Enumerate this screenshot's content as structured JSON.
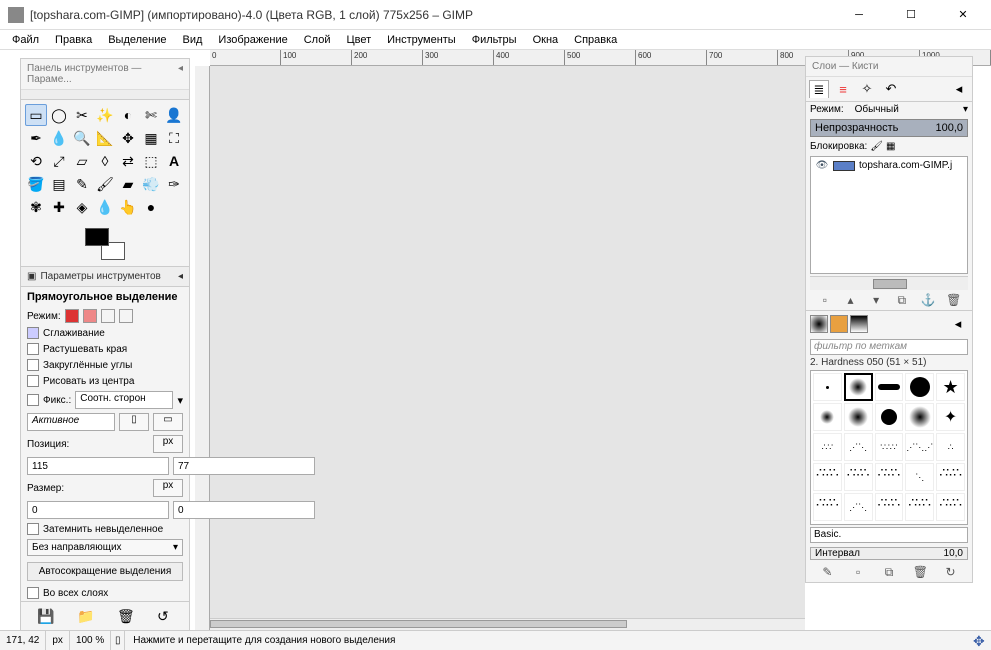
{
  "title": "[topshara.com-GIMP] (импортировано)-4.0 (Цвета RGB, 1 слой) 775x256 – GIMP",
  "menu": [
    "Файл",
    "Правка",
    "Выделение",
    "Вид",
    "Изображение",
    "Слой",
    "Цвет",
    "Инструменты",
    "Фильтры",
    "Окна",
    "Справка"
  ],
  "toolbox": {
    "header": "Панель инструментов — Параме...",
    "opts_label": "Параметры инструментов",
    "selection_title": "Прямоугольное выделение",
    "mode_label": "Режим:",
    "smooth": "Сглаживание",
    "feather": "Растушевать края",
    "rounded": "Закруглённые углы",
    "center": "Рисовать из центра",
    "fix_label": "Фикс.:",
    "fix_value": "Соотн. сторон",
    "active": "Активное",
    "pos_label": "Позиция:",
    "pos_x": "115",
    "pos_y": "77",
    "size_label": "Размер:",
    "size_x": "0",
    "size_y": "0",
    "px": "px",
    "darken": "Затемнить невыделенное",
    "guides": "Без направляющих",
    "autoshrink": "Автосокращение выделения",
    "alllayers": "Во всех слоях"
  },
  "rightdock": {
    "header": "Слои — Кисти",
    "mode_label": "Режим:",
    "mode_value": "Обычный",
    "opacity_label": "Непрозрачность",
    "opacity_value": "100,0",
    "lock_label": "Блокировка:",
    "layer_name": "topshara.com-GIMP.j",
    "brush_filter": "фильтр по меткам",
    "brush_info": "2. Hardness 050 (51 × 51)",
    "brush_basic": "Basic.",
    "interval_label": "Интервал",
    "interval_value": "10,0"
  },
  "status": {
    "coords": "171, 42",
    "unit": "px",
    "zoom": "100 %",
    "hint": "Нажмите и перетащите для создания нового выделения"
  },
  "ruler_ticks": [
    "0",
    "100",
    "200",
    "300",
    "400",
    "500",
    "600",
    "700",
    "800",
    "900",
    "1000"
  ]
}
